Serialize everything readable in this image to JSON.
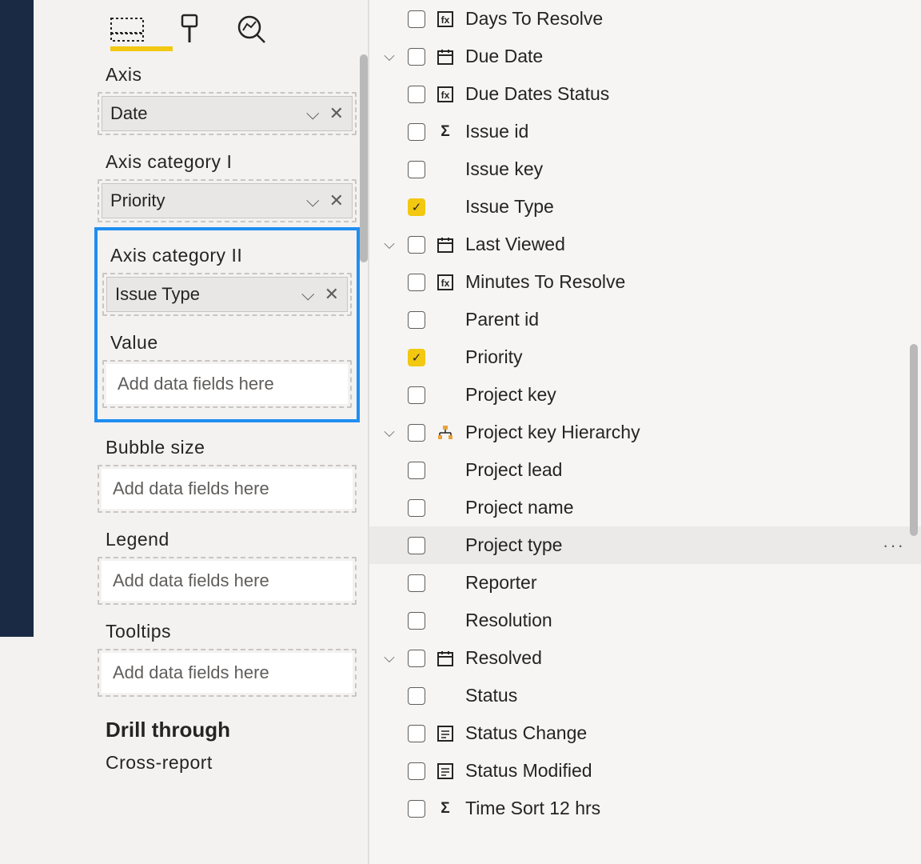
{
  "viz": {
    "wells": [
      {
        "label": "Axis",
        "chip": "Date",
        "placeholder": null
      },
      {
        "label": "Axis category I",
        "chip": "Priority",
        "placeholder": null
      },
      {
        "label": "Axis category II",
        "chip": "Issue Type",
        "placeholder": null,
        "highlighted": true
      },
      {
        "label": "Value",
        "chip": null,
        "placeholder": "Add data fields here",
        "highlighted": true
      },
      {
        "label": "Bubble size",
        "chip": null,
        "placeholder": "Add data fields here"
      },
      {
        "label": "Legend",
        "chip": null,
        "placeholder": "Add data fields here"
      },
      {
        "label": "Tooltips",
        "chip": null,
        "placeholder": "Add data fields here"
      }
    ],
    "drill_heading": "Drill through",
    "cross_report": "Cross-report"
  },
  "fields": [
    {
      "label": "Days To Resolve",
      "icon": "calc",
      "checked": false,
      "expand": ""
    },
    {
      "label": "Due Date",
      "icon": "cal",
      "checked": false,
      "expand": "v"
    },
    {
      "label": "Due Dates Status",
      "icon": "calc",
      "checked": false,
      "expand": ""
    },
    {
      "label": "Issue id",
      "icon": "sigma",
      "checked": false,
      "expand": ""
    },
    {
      "label": "Issue key",
      "icon": "",
      "checked": false,
      "expand": ""
    },
    {
      "label": "Issue Type",
      "icon": "",
      "checked": true,
      "expand": ""
    },
    {
      "label": "Last Viewed",
      "icon": "cal",
      "checked": false,
      "expand": "v"
    },
    {
      "label": "Minutes To Resolve",
      "icon": "calc",
      "checked": false,
      "expand": ""
    },
    {
      "label": "Parent id",
      "icon": "",
      "checked": false,
      "expand": ""
    },
    {
      "label": "Priority",
      "icon": "",
      "checked": true,
      "expand": ""
    },
    {
      "label": "Project key",
      "icon": "",
      "checked": false,
      "expand": ""
    },
    {
      "label": "Project key Hierarchy",
      "icon": "hier",
      "checked": false,
      "expand": "v"
    },
    {
      "label": "Project lead",
      "icon": "",
      "checked": false,
      "expand": ""
    },
    {
      "label": "Project name",
      "icon": "",
      "checked": false,
      "expand": ""
    },
    {
      "label": "Project type",
      "icon": "",
      "checked": false,
      "expand": "",
      "hover": true
    },
    {
      "label": "Reporter",
      "icon": "",
      "checked": false,
      "expand": ""
    },
    {
      "label": "Resolution",
      "icon": "",
      "checked": false,
      "expand": ""
    },
    {
      "label": "Resolved",
      "icon": "cal",
      "checked": false,
      "expand": "v"
    },
    {
      "label": "Status",
      "icon": "",
      "checked": false,
      "expand": ""
    },
    {
      "label": "Status Change",
      "icon": "calc2",
      "checked": false,
      "expand": ""
    },
    {
      "label": "Status Modified",
      "icon": "calc2",
      "checked": false,
      "expand": ""
    },
    {
      "label": "Time Sort 12 hrs",
      "icon": "sigma",
      "checked": false,
      "expand": ""
    }
  ]
}
